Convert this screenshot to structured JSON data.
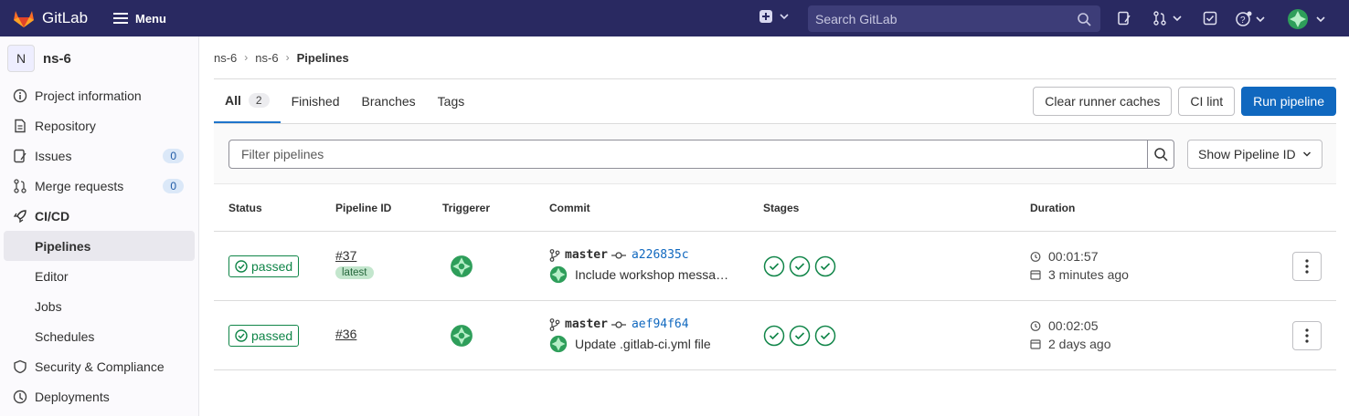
{
  "topbar": {
    "brand": "GitLab",
    "menu_label": "Menu",
    "search_placeholder": "Search GitLab"
  },
  "sidebar": {
    "project_initial": "N",
    "project_name": "ns-6",
    "items": [
      {
        "label": "Project information",
        "icon": "info-icon"
      },
      {
        "label": "Repository",
        "icon": "doc-icon"
      },
      {
        "label": "Issues",
        "icon": "issues-icon",
        "count": "0"
      },
      {
        "label": "Merge requests",
        "icon": "merge-request-icon",
        "count": "0"
      },
      {
        "label": "CI/CD",
        "icon": "rocket-icon"
      },
      {
        "label": "Pipelines"
      },
      {
        "label": "Editor"
      },
      {
        "label": "Jobs"
      },
      {
        "label": "Schedules"
      },
      {
        "label": "Security & Compliance",
        "icon": "shield-icon"
      },
      {
        "label": "Deployments",
        "icon": "deploy-icon"
      }
    ]
  },
  "breadcrumb": [
    "ns-6",
    "ns-6",
    "Pipelines"
  ],
  "tabs": [
    {
      "label": "All",
      "count": "2"
    },
    {
      "label": "Finished"
    },
    {
      "label": "Branches"
    },
    {
      "label": "Tags"
    }
  ],
  "actions": {
    "clear_caches": "Clear runner caches",
    "ci_lint": "CI lint",
    "run_pipeline": "Run pipeline"
  },
  "filter": {
    "placeholder": "Filter pipelines",
    "show_id": "Show Pipeline ID"
  },
  "table": {
    "headers": [
      "Status",
      "Pipeline ID",
      "Triggerer",
      "Commit",
      "Stages",
      "Duration"
    ],
    "rows": [
      {
        "status": "passed",
        "pipeline_id": "#37",
        "tag": "latest",
        "branch": "master",
        "sha": "a226835c",
        "commit_title": "Include workshop messa…",
        "duration": "00:01:57",
        "finished": "3 minutes ago"
      },
      {
        "status": "passed",
        "pipeline_id": "#36",
        "branch": "master",
        "sha": "aef94f64",
        "commit_title": "Update .gitlab-ci.yml file",
        "duration": "00:02:05",
        "finished": "2 days ago"
      }
    ]
  },
  "colors": {
    "topbar": "#292961",
    "success": "#108548",
    "primary": "#1068bf"
  }
}
